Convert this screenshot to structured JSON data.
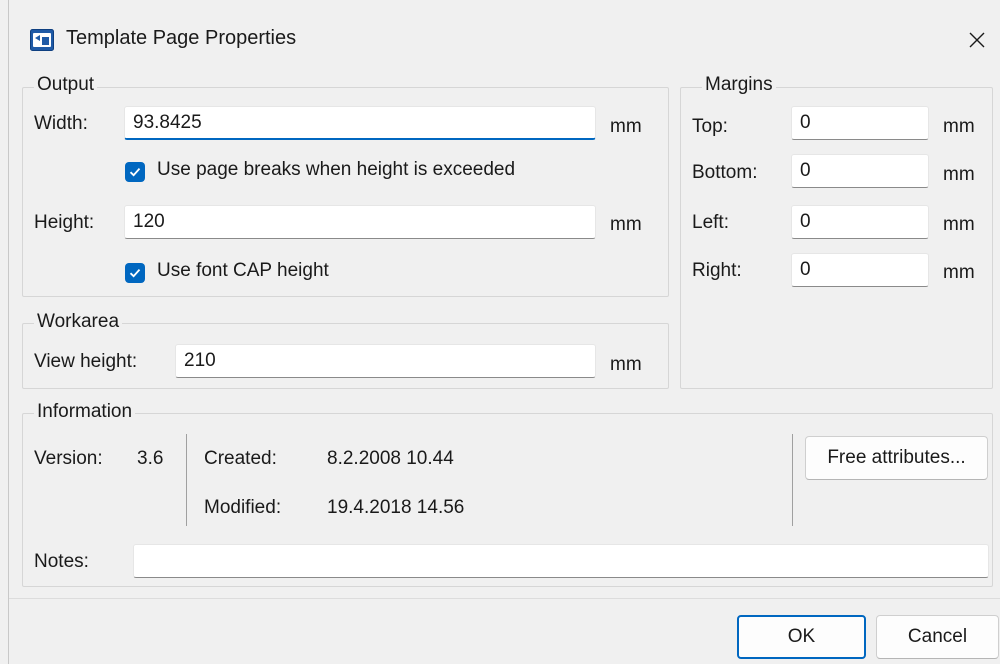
{
  "window": {
    "title": "Template Page Properties",
    "close_icon": "close-icon",
    "app_icon": "template-page-app-icon"
  },
  "output": {
    "legend": "Output",
    "width_label": "Width:",
    "width_value": "93.8425",
    "width_unit": "mm",
    "page_breaks_label": "Use page breaks when height is exceeded",
    "page_breaks_checked": true,
    "height_label": "Height:",
    "height_value": "120",
    "height_unit": "mm",
    "cap_height_label": "Use font CAP height",
    "cap_height_checked": true
  },
  "margins": {
    "legend": "Margins",
    "top_label": "Top:",
    "top_value": "0",
    "top_unit": "mm",
    "bottom_label": "Bottom:",
    "bottom_value": "0",
    "bottom_unit": "mm",
    "left_label": "Left:",
    "left_value": "0",
    "left_unit": "mm",
    "right_label": "Right:",
    "right_value": "0",
    "right_unit": "mm"
  },
  "workarea": {
    "legend": "Workarea",
    "view_height_label": "View height:",
    "view_height_value": "210",
    "view_height_unit": "mm"
  },
  "information": {
    "legend": "Information",
    "version_label": "Version:",
    "version_value": "3.6",
    "created_label": "Created:",
    "created_value": "8.2.2008 10.44",
    "modified_label": "Modified:",
    "modified_value": "19.4.2018 14.56",
    "free_attributes_label": "Free attributes...",
    "notes_label": "Notes:",
    "notes_value": ""
  },
  "buttons": {
    "ok_label": "OK",
    "cancel_label": "Cancel"
  },
  "colors": {
    "accent": "#0067c0",
    "background": "#f0f0f0"
  }
}
